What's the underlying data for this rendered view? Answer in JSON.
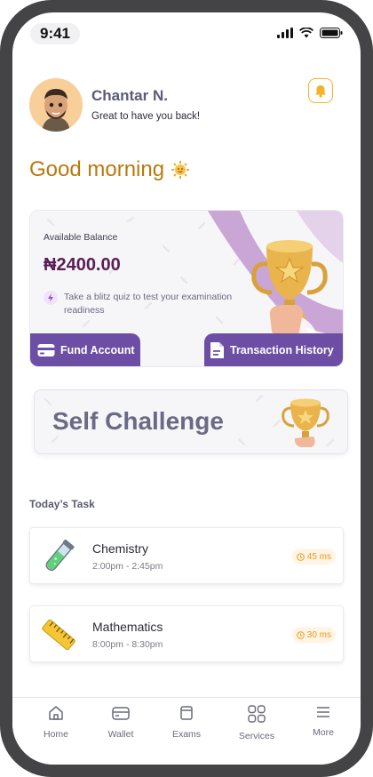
{
  "status_bar": {
    "time": "9:41"
  },
  "header": {
    "user_name": "Chantar N.",
    "subtitle": "Great to have you back!",
    "greeting": "Good morning"
  },
  "balance_card": {
    "label": "Available Balance",
    "amount": "₦2400.00",
    "quiz_prompt": "Take a blitz quiz to test your examination readiness",
    "fund_button": "Fund Account",
    "history_button": "Transaction History"
  },
  "challenge": {
    "title": "Self Challenge"
  },
  "tasks": {
    "section_title": "Today’s Task",
    "items": [
      {
        "name": "Chemistry",
        "time": "2:00pm - 2:45pm",
        "duration": "45 ms"
      },
      {
        "name": "Mathematics",
        "time": "8:00pm - 8:30pm",
        "duration": "30 ms"
      }
    ]
  },
  "nav": {
    "items": [
      {
        "label": "Home",
        "icon": "home-icon"
      },
      {
        "label": "Wallet",
        "icon": "wallet-icon"
      },
      {
        "label": "Exams",
        "icon": "exams-icon"
      },
      {
        "label": "Services",
        "icon": "services-icon"
      },
      {
        "label": "More",
        "icon": "menu-icon"
      }
    ]
  },
  "colors": {
    "accent": "#6c4fa4",
    "greeting": "#b8790c",
    "amount": "#5a1e54",
    "badge": "#e69a12"
  }
}
